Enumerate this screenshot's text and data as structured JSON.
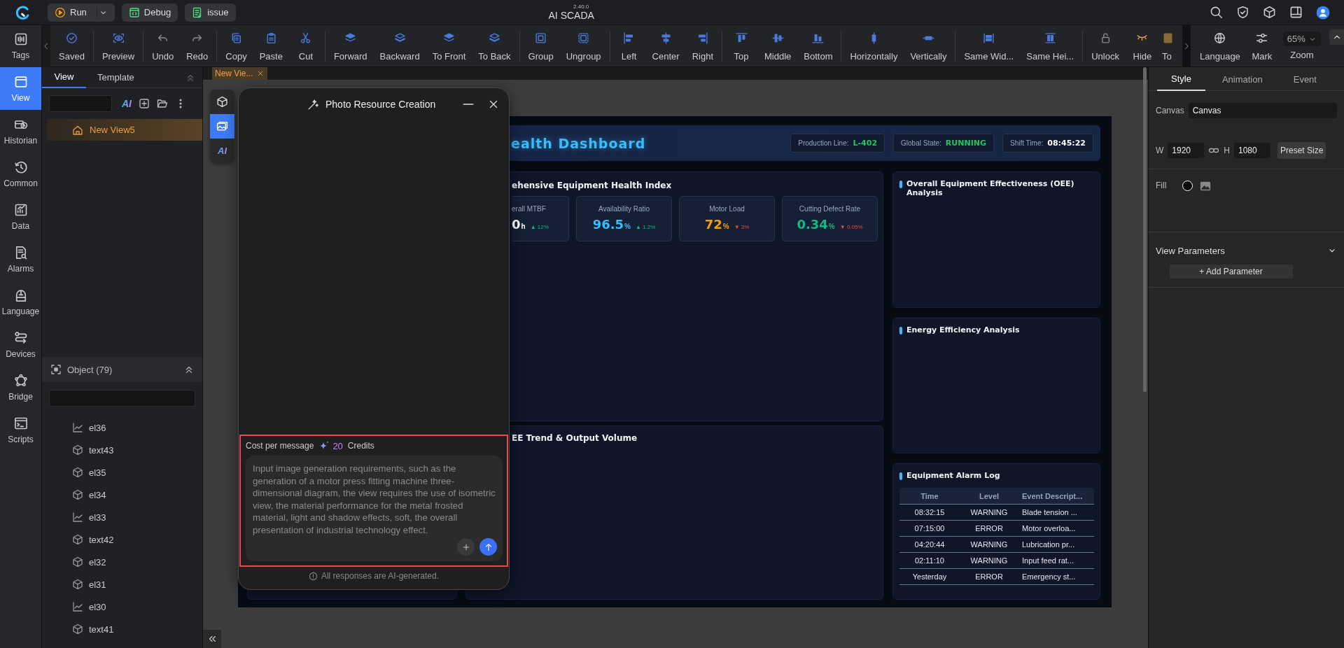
{
  "top_bar": {
    "buttons": [
      {
        "label": "Run",
        "kind": "run"
      },
      {
        "label": "Debug",
        "kind": "debug"
      },
      {
        "label": "issue",
        "kind": "issue"
      }
    ],
    "version": "2.40.0",
    "title": "AI SCADA"
  },
  "toolbar": {
    "groups": [
      [
        "Saved"
      ],
      [
        "Preview"
      ],
      [
        "Undo",
        "Redo"
      ],
      [
        "Copy",
        "Paste",
        "Cut"
      ],
      [
        "Forward",
        "Backward",
        "To Front",
        "To Back"
      ],
      [
        "Group",
        "Ungroup"
      ],
      [
        "Left",
        "Center",
        "Right"
      ],
      [
        "Top",
        "Middle",
        "Bottom"
      ],
      [
        "Horizontally",
        "Vertically"
      ],
      [
        "Same Wid...",
        "Same Hei..."
      ],
      [
        "Unlock",
        "Hide",
        "To"
      ]
    ],
    "tools": [
      "Language",
      "Mark",
      "Zoom"
    ],
    "zoom_value": "65%"
  },
  "nav": [
    {
      "label": "Tags",
      "selected": false
    },
    {
      "label": "View",
      "selected": true
    },
    {
      "label": "Historian",
      "selected": false
    },
    {
      "label": "Common",
      "selected": false
    },
    {
      "label": "Data",
      "selected": false
    },
    {
      "label": "Alarms",
      "selected": false
    },
    {
      "label": "Language",
      "selected": false
    },
    {
      "label": "Devices",
      "selected": false
    },
    {
      "label": "Bridge",
      "selected": false
    },
    {
      "label": "Scripts",
      "selected": false
    }
  ],
  "left_panel": {
    "tabs": [
      {
        "label": "View",
        "selected": true
      },
      {
        "label": "Template",
        "selected": false
      }
    ],
    "ai_label": "AI",
    "views": [
      {
        "label": "New View5",
        "selected": true
      }
    ],
    "objects": {
      "title": "Object (79)",
      "items": [
        {
          "label": "el36",
          "kind": "chart"
        },
        {
          "label": "text43",
          "kind": "shape"
        },
        {
          "label": "el35",
          "kind": "shape"
        },
        {
          "label": "el34",
          "kind": "shape"
        },
        {
          "label": "el33",
          "kind": "chart"
        },
        {
          "label": "text42",
          "kind": "shape"
        },
        {
          "label": "el32",
          "kind": "shape"
        },
        {
          "label": "el31",
          "kind": "shape"
        },
        {
          "label": "el30",
          "kind": "chart"
        },
        {
          "label": "text41",
          "kind": "shape"
        }
      ]
    }
  },
  "document_tabs": [
    {
      "label": "New Vie...",
      "selected": true
    }
  ],
  "tool_strip": [
    {
      "kind": "model",
      "selected": false
    },
    {
      "kind": "photo",
      "selected": true
    },
    {
      "kind": "ai",
      "label": "AI",
      "selected": false
    }
  ],
  "dialog": {
    "title": "Photo Resource Creation",
    "cost_label": "Cost per message",
    "cost_amount": "20",
    "cost_unit": "Credits",
    "prompt_placeholder": "Input image generation requirements, such as the generation of a motor press fitting machine three-dimensional diagram, the view requires the use of isometric view, the material performance for the metal frosted material, light and shadow effects, soft, the overall presentation of industrial technology effect.",
    "footer": "All responses are AI-generated."
  },
  "dashboard": {
    "title": "ealth Dashboard",
    "status": [
      {
        "label": "Production Line:",
        "value": "L-402",
        "color": "#22c55e"
      },
      {
        "label": "Global State:",
        "value": "RUNNING",
        "color": "#22c55e"
      },
      {
        "label": "Shift Time:",
        "value": "08:45:22",
        "color": "#ffffff"
      }
    ],
    "health_panel": {
      "title": "ehensive Equipment Health Index",
      "kpis": [
        {
          "label": "erall MTBF",
          "value": "0",
          "unit": "h",
          "color": "#ffffff",
          "delta": {
            "text": "▲ 12%",
            "color": "#10b981"
          }
        },
        {
          "label": "Availability Ratio",
          "value": "96.5",
          "unit": "%",
          "color": "#38bdf8",
          "delta": {
            "text": "▲ 1.2%",
            "color": "#10b981"
          }
        },
        {
          "label": "Motor Load",
          "value": "72",
          "unit": "%",
          "color": "#f59e0b",
          "delta": {
            "text": "▼ 3%",
            "color": "#ef4444"
          }
        },
        {
          "label": "Cutting Defect Rate",
          "value": "0.34",
          "unit": "%",
          "color": "#10b981",
          "delta": {
            "text": "▼ 0.05%",
            "color": "#ef4444"
          }
        }
      ]
    },
    "trend_panel": {
      "title": "EE Trend & Output Volume"
    },
    "side_panels": [
      {
        "title": "Overall Equipment Effectiveness (OEE) Analysis"
      },
      {
        "title": "Energy Efficiency Analysis"
      }
    ],
    "alarm_log": {
      "title": "Equipment Alarm Log",
      "columns": [
        "Time",
        "Level",
        "Event Descript..."
      ],
      "rows": [
        [
          "08:32:15",
          "WARNING",
          "Blade tension ..."
        ],
        [
          "07:15:00",
          "ERROR",
          "Motor overloa..."
        ],
        [
          "04:20:44",
          "WARNING",
          "Lubrication pr..."
        ],
        [
          "02:11:10",
          "WARNING",
          "Input feed rat..."
        ],
        [
          "Yesterday",
          "ERROR",
          "Emergency st..."
        ]
      ]
    }
  },
  "right_panel": {
    "tabs": [
      {
        "label": "Style",
        "selected": true
      },
      {
        "label": "Animation",
        "selected": false
      },
      {
        "label": "Event",
        "selected": false
      }
    ],
    "canvas_label": "Canvas",
    "canvas_value": "Canvas",
    "width_label": "W",
    "width_value": "1920",
    "height_label": "H",
    "height_value": "1080",
    "preset_button": "Preset Size",
    "fill_label": "Fill",
    "parameters": {
      "title": "View Parameters",
      "expanded": true,
      "add_button": "+ Add Parameter"
    }
  }
}
